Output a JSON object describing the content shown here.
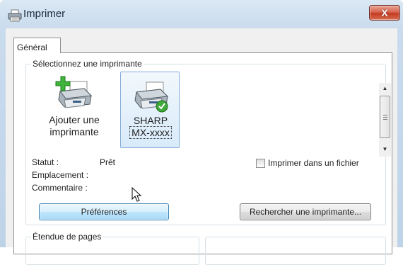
{
  "window": {
    "title": "Imprimer",
    "close_symbol": "X"
  },
  "tabs": [
    {
      "label": "Général"
    }
  ],
  "select_printer": {
    "group_label": "Sélectionnez une imprimante",
    "printers": [
      {
        "label_line1": "Ajouter une",
        "label_line2": "imprimante",
        "icon": "add-printer-icon",
        "selected": false
      },
      {
        "label_line1": "SHARP",
        "label_line2": "MX-xxxx",
        "icon": "default-printer-icon",
        "selected": true
      }
    ],
    "status_label": "Statut :",
    "status_value": "Prêt",
    "location_label": "Emplacement :",
    "comment_label": "Commentaire :",
    "print_to_file_label": "Imprimer dans un fichier",
    "print_to_file_checked": false,
    "preferences_button": "Préférences",
    "find_printer_button": "Rechercher une imprimante..."
  },
  "page_range": {
    "group_label": "Étendue de pages"
  },
  "colors": {
    "accent_close": "#c2391f",
    "selection_border": "#84acdd",
    "hot_button_border": "#3c7fb1"
  }
}
